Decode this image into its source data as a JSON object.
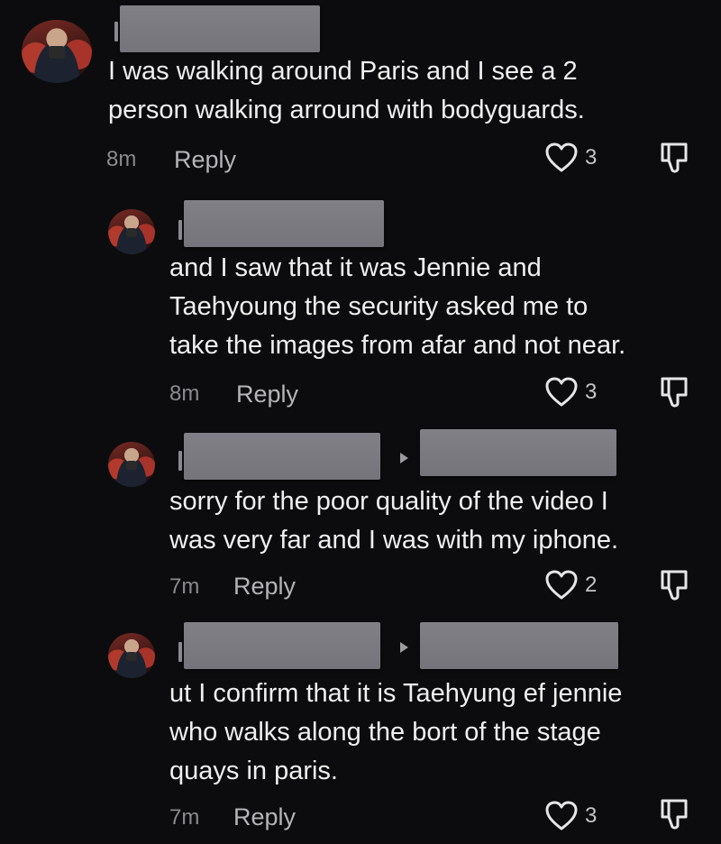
{
  "comments": [
    {
      "text": "I was walking around Paris and I see a 2\nperson walking arround with bodyguards.",
      "time": "8m",
      "reply_label": "Reply",
      "likes": "3"
    },
    {
      "text": "and I saw that it was Jennie and\nTaehyoung the security asked me to\ntake the images from afar and not near.",
      "time": "8m",
      "reply_label": "Reply",
      "likes": "3"
    },
    {
      "text": "sorry for the poor quality of the video I\nwas very far and I was with my iphone.",
      "time": "7m",
      "reply_label": "Reply",
      "likes": "2"
    },
    {
      "text": "ut I confirm that it is Taehyung ef jennie\nwho walks along the bort of the stage\nquays in paris.",
      "time": "7m",
      "reply_label": "Reply",
      "likes": "3"
    }
  ],
  "icons": {
    "like": "heart-outline-icon",
    "dislike": "thumbs-down-outline-icon",
    "reply_to": "triangle-right-icon"
  },
  "colors": {
    "background": "#0c0c0e",
    "text": "#efefef",
    "muted": "#8b8b8f",
    "redaction": "#7a7a80"
  }
}
